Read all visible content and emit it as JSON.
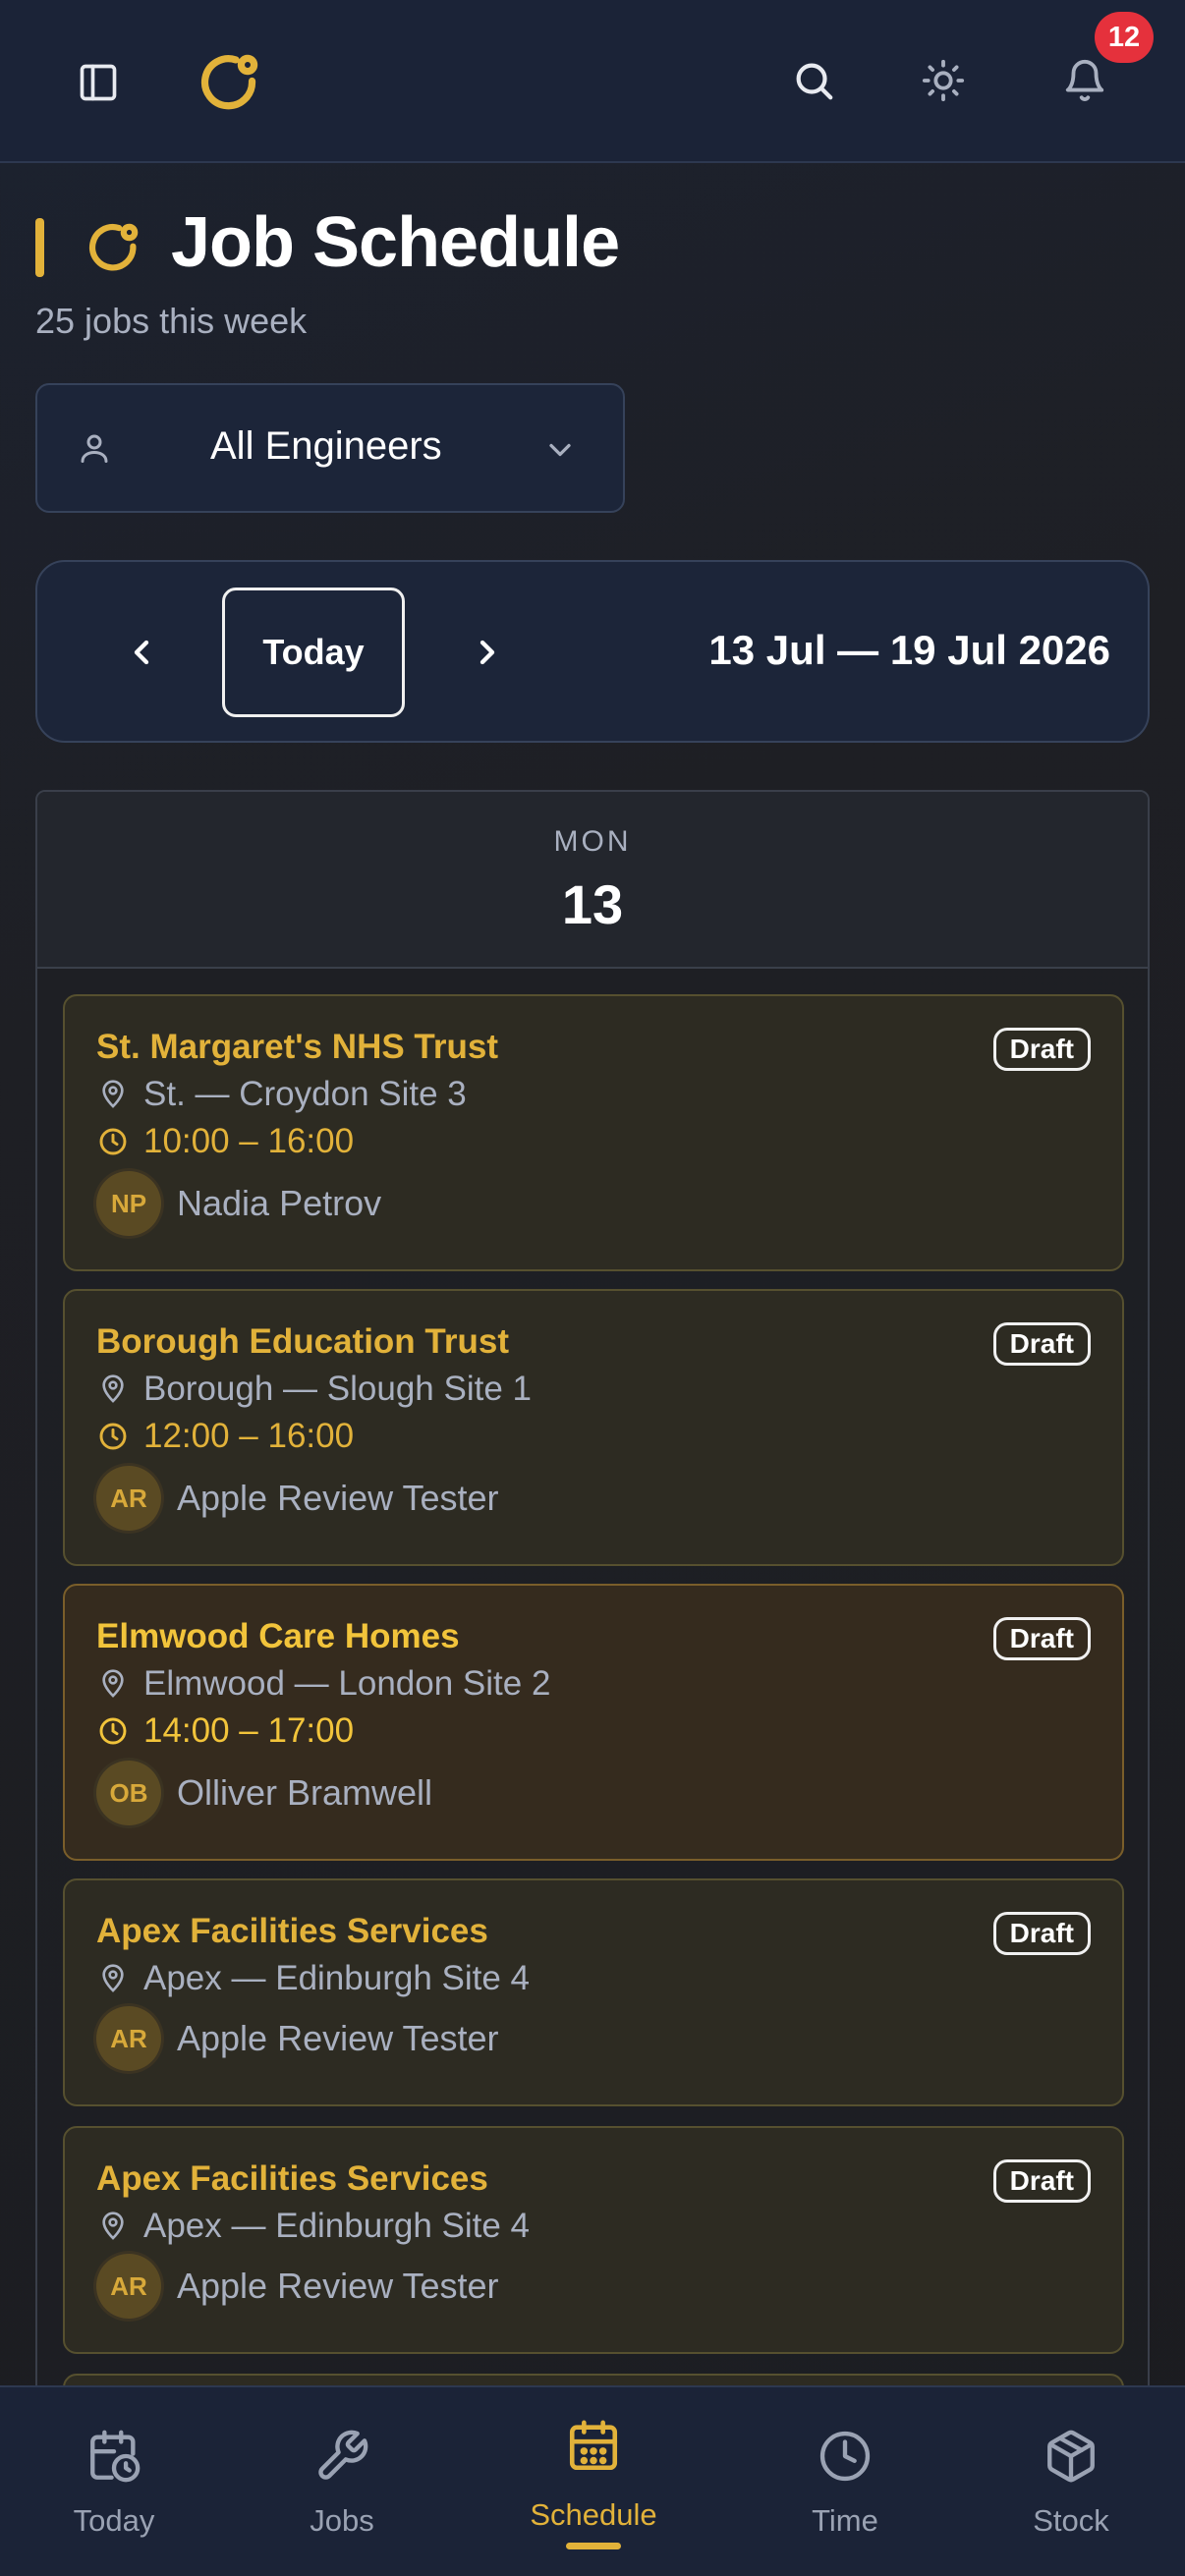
{
  "topbar": {
    "notification_count": "12",
    "icons": [
      "sidebar-toggle-icon",
      "logo-icon",
      "search-icon",
      "theme-toggle-icon",
      "bell-icon"
    ]
  },
  "header": {
    "title": "Job Schedule",
    "subtitle": "25 jobs this week"
  },
  "filter": {
    "engineer_label": "All Engineers"
  },
  "week_nav": {
    "today_label": "Today",
    "range": "13 Jul — 19 Jul 2026"
  },
  "day": {
    "dow": "MON",
    "date": "13"
  },
  "jobs": [
    {
      "name": "St. Margaret's NHS Trust",
      "status": "Draft",
      "location": "St. — Croydon Site 3",
      "time": "10:00 – 16:00",
      "initials": "NP",
      "engineer": "Nadia Petrov"
    },
    {
      "name": "Borough Education Trust",
      "status": "Draft",
      "location": "Borough — Slough Site 1",
      "time": "12:00 – 16:00",
      "initials": "AR",
      "engineer": "Apple Review Tester"
    },
    {
      "name": "Elmwood Care Homes",
      "status": "Draft",
      "location": "Elmwood — London Site 2",
      "time": "14:00 – 17:00",
      "initials": "OB",
      "engineer": "Olliver Bramwell"
    },
    {
      "name": "Apex Facilities Services",
      "status": "Draft",
      "location": "Apex — Edinburgh Site 4",
      "initials": "AR",
      "engineer": "Apple Review Tester"
    },
    {
      "name": "Apex Facilities Services",
      "status": "Draft",
      "location": "Apex — Edinburgh Site 4",
      "initials": "AR",
      "engineer": "Apple Review Tester"
    }
  ],
  "bottom_nav": [
    {
      "label": "Today",
      "icon": "calendar-clock-icon"
    },
    {
      "label": "Jobs",
      "icon": "wrench-icon"
    },
    {
      "label": "Schedule",
      "icon": "calendar-icon",
      "active": true
    },
    {
      "label": "Time",
      "icon": "clock-icon"
    },
    {
      "label": "Stock",
      "icon": "box-icon"
    }
  ],
  "colors": {
    "accent": "#e2b23a",
    "background": "#1e1f24",
    "bar": "#1b2337",
    "badge": "#e5313c"
  }
}
